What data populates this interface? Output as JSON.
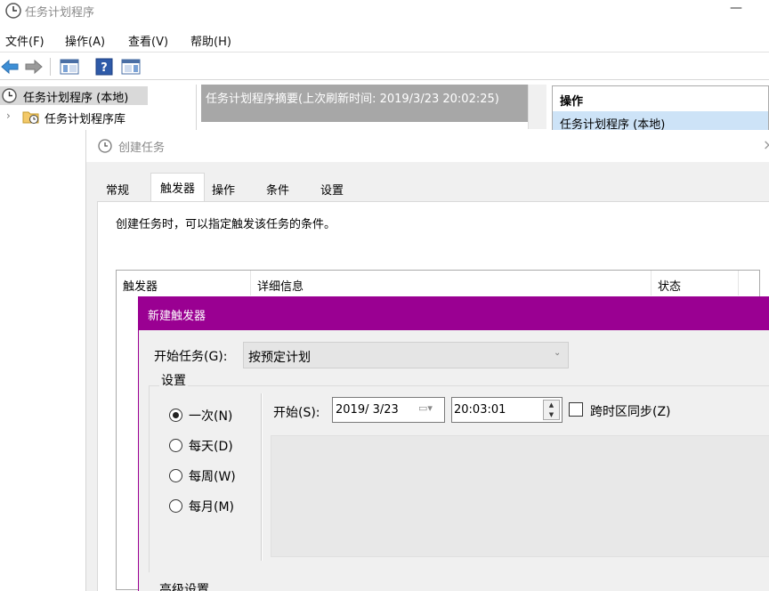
{
  "window": {
    "title": "任务计划程序",
    "minimize": "—"
  },
  "menu": {
    "file": "文件(F)",
    "action": "操作(A)",
    "view": "查看(V)",
    "help": "帮助(H)"
  },
  "tree": {
    "root": "任务计划程序 (本地)",
    "child": "任务计划程序库"
  },
  "summary": {
    "text": "任务计划程序摘要(上次刷新时间: 2019/3/23 20:02:25)"
  },
  "actions": {
    "title": "操作",
    "item": "任务计划程序 (本地)"
  },
  "create_task": {
    "title": "创建任务",
    "close": "×",
    "tabs": [
      "常规",
      "触发器",
      "操作",
      "条件",
      "设置"
    ],
    "description": "创建任务时，可以指定触发该任务的条件。",
    "columns": [
      "触发器",
      "详细信息",
      "状态"
    ]
  },
  "new_trigger": {
    "title": "新建触发器",
    "start_task_label": "开始任务(G):",
    "start_task_value": "按预定计划",
    "settings_label": "设置",
    "radios": [
      "一次(N)",
      "每天(D)",
      "每周(W)",
      "每月(M)"
    ],
    "selected_radio": "一次(N)",
    "start_label": "开始(S):",
    "date_value": "2019/ 3/23",
    "time_value": "20:03:01",
    "timezone_sync_label": "跨时区同步(Z)",
    "timezone_sync_checked": false,
    "advanced_label": "高级设置"
  },
  "colors": {
    "purple_title": "#9a0092",
    "summary_bg": "#a7a7a7",
    "selection_blue": "#cde3f7"
  }
}
